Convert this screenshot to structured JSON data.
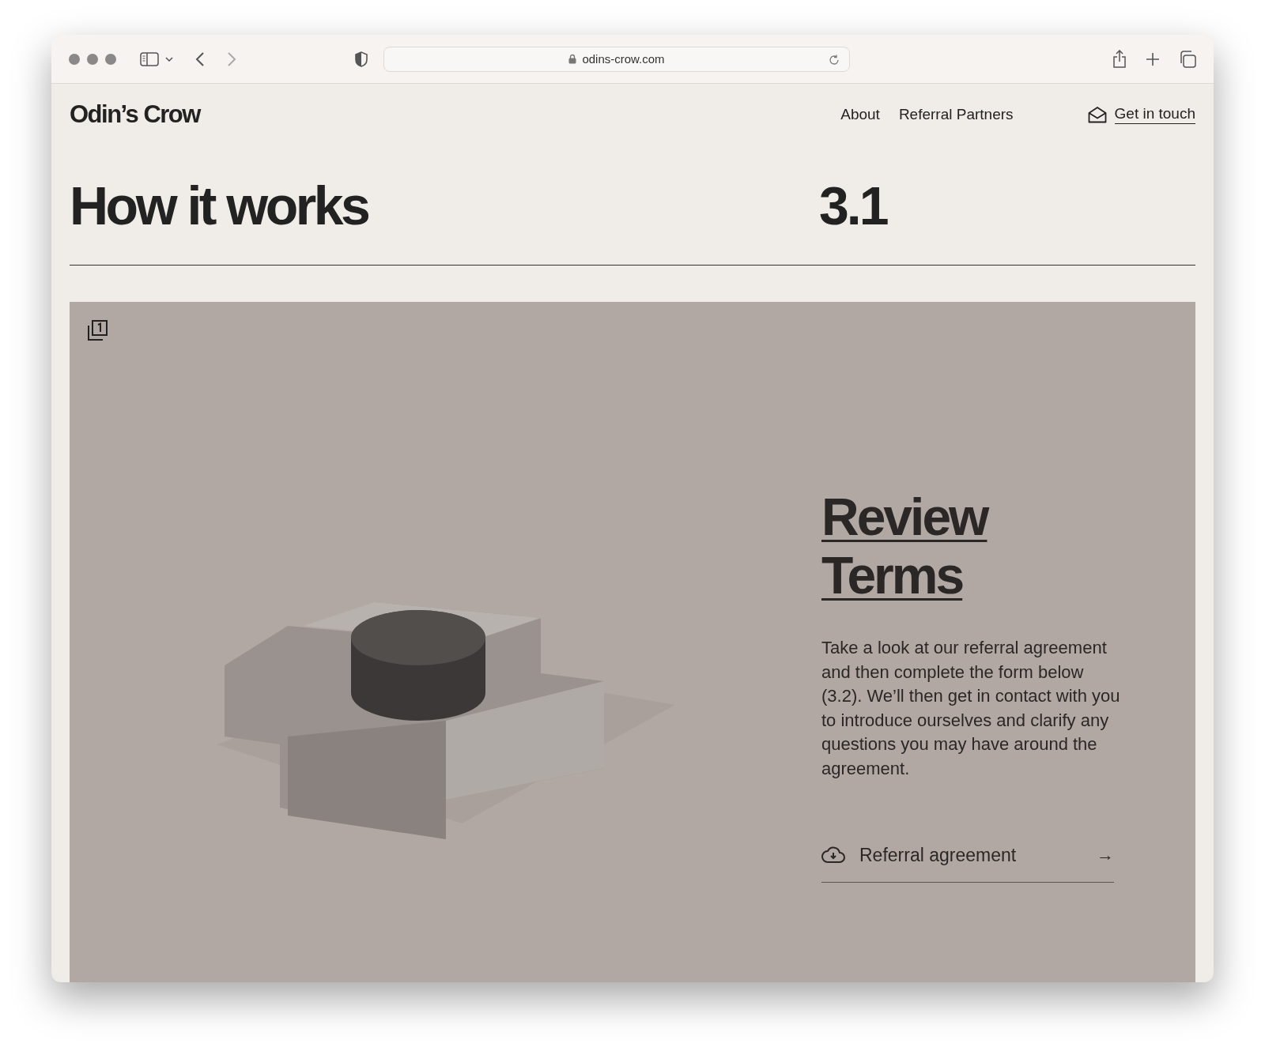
{
  "browser": {
    "url": "odins-crow.com"
  },
  "site": {
    "logo": "Odin’s Crow",
    "nav": [
      {
        "label": "About"
      },
      {
        "label": "Referral Partners"
      }
    ],
    "contact_link": "Get in touch"
  },
  "section": {
    "title": "How it works",
    "number": "3.1"
  },
  "panel": {
    "heading": "Review Terms",
    "body": "Take a look at our referral agreement and then complete the form below (3.2). We’ll then get in contact with you to introduce ourselves and clarify any questions you may have around the agreement.",
    "download": {
      "label": "Referral agreement",
      "arrow": "→"
    }
  }
}
